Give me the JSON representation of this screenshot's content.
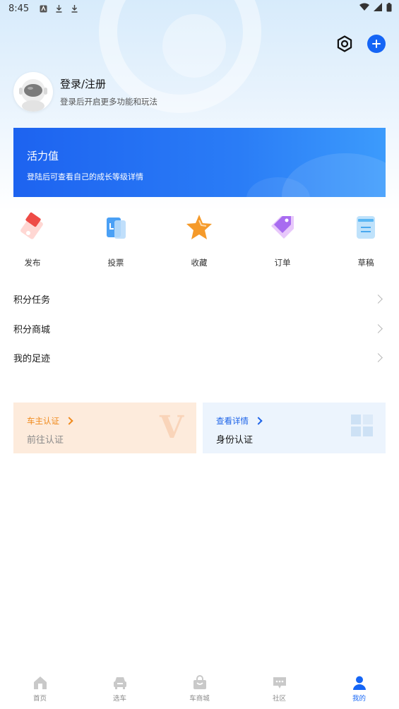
{
  "status_bar": {
    "time": "8:45"
  },
  "profile": {
    "title": "登录/注册",
    "subtitle": "登录后开启更多功能和玩法"
  },
  "vitality": {
    "title": "活力值",
    "subtitle": "登陆后可查看自己的成长等级详情"
  },
  "quick_actions": [
    {
      "label": "发布",
      "icon": "publish-icon"
    },
    {
      "label": "投票",
      "icon": "vote-icon"
    },
    {
      "label": "收藏",
      "icon": "favorite-star-icon"
    },
    {
      "label": "订单",
      "icon": "order-tag-icon"
    },
    {
      "label": "草稿",
      "icon": "draft-icon"
    }
  ],
  "menu": [
    {
      "label": "积分任务"
    },
    {
      "label": "积分商城"
    },
    {
      "label": "我的足迹"
    }
  ],
  "cards": {
    "owner": {
      "title": "车主认证",
      "subtitle": "前往认证",
      "mark": "V"
    },
    "identity": {
      "title": "查看详情",
      "subtitle": "身份认证"
    }
  },
  "bottom_nav": [
    {
      "label": "首页",
      "icon": "home-icon",
      "active": false
    },
    {
      "label": "选车",
      "icon": "car-icon",
      "active": false
    },
    {
      "label": "车商城",
      "icon": "shopping-bag-icon",
      "active": false
    },
    {
      "label": "社区",
      "icon": "chat-bubble-icon",
      "active": false
    },
    {
      "label": "我的",
      "icon": "user-icon",
      "active": true
    }
  ],
  "colors": {
    "accent": "#1565f5",
    "owner_card_bg": "#fdebdc",
    "owner_accent": "#f08a1c",
    "identity_card_bg": "#ecf4fd"
  }
}
